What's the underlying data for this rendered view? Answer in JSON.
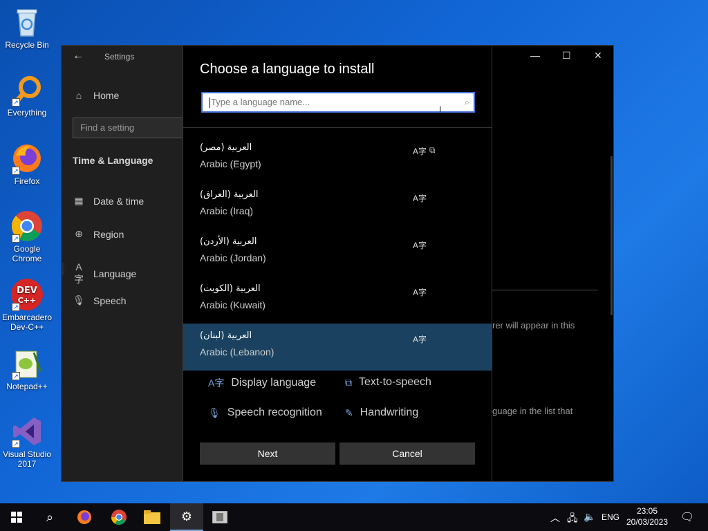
{
  "desktop": {
    "icons": [
      {
        "label": "Recycle Bin"
      },
      {
        "label": "Everything"
      },
      {
        "label": "Firefox"
      },
      {
        "label": "Google Chrome"
      },
      {
        "label": "Embarcadero Dev-C++"
      },
      {
        "label": "Notepad++"
      },
      {
        "label": "Visual Studio 2017"
      }
    ]
  },
  "settings": {
    "title": "Settings",
    "home": "Home",
    "find_placeholder": "Find a setting",
    "section": "Time & Language",
    "nav": [
      "Date & time",
      "Region",
      "Language",
      "Speech"
    ],
    "right_fragments": {
      "frag1": "rer will appear in this",
      "frag2": "guage in the list that"
    }
  },
  "dialog": {
    "title": "Choose a language to install",
    "search_placeholder": "Type a language name...",
    "languages": [
      {
        "native": "العربية (مصر)",
        "english": "Arabic (Egypt)"
      },
      {
        "native": "العربية (العراق)",
        "english": "Arabic (Iraq)"
      },
      {
        "native": "العربية (الأردن)",
        "english": "Arabic (Jordan)"
      },
      {
        "native": "العربية (الكويت)",
        "english": "Arabic (Kuwait)"
      },
      {
        "native": "العربية (لبنان)",
        "english": "Arabic (Lebanon)"
      }
    ],
    "features": {
      "display": "Display language",
      "tts": "Text-to-speech",
      "speech": "Speech recognition",
      "handwriting": "Handwriting"
    },
    "next_label": "Next",
    "cancel_label": "Cancel"
  },
  "taskbar": {
    "lang": "ENG",
    "time": "23:05",
    "date": "20/03/2023"
  }
}
